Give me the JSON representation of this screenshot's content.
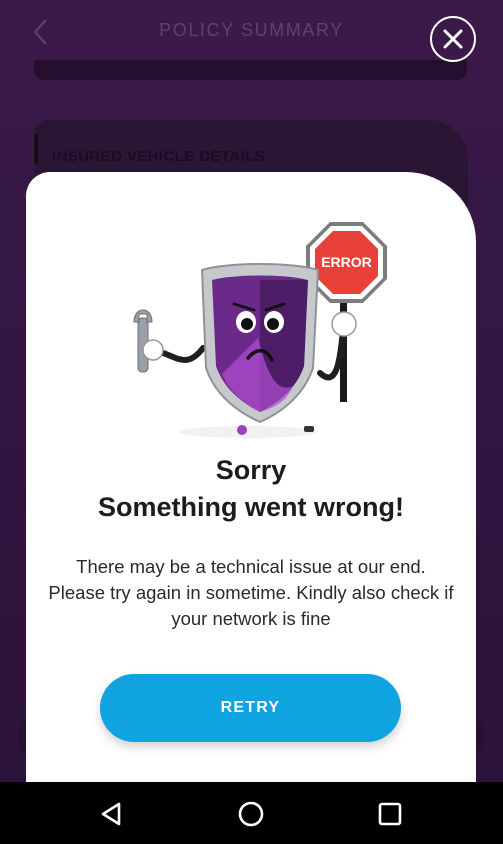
{
  "header": {
    "title": "POLICY SUMMARY"
  },
  "vehicle_card": {
    "title": "INSURED VEHICLE DETAILS"
  },
  "modal": {
    "sign_text": "ERROR",
    "title_line1": "Sorry",
    "title_line2": "Something went wrong!",
    "message": "There may be a technical issue at our end. Please try again in sometime. Kindly also check if your network is fine",
    "retry_label": "RETRY"
  },
  "icons": {
    "back": "chevron-left-icon",
    "close": "close-icon",
    "nav_back": "triangle-back-icon",
    "nav_home": "circle-home-icon",
    "nav_recent": "square-recent-icon"
  },
  "colors": {
    "background": "#3a1a49",
    "modal": "#ffffff",
    "retry_button": "#0fa3e0",
    "error_sign": "#e8413a",
    "shield": "#6b2a8a"
  }
}
